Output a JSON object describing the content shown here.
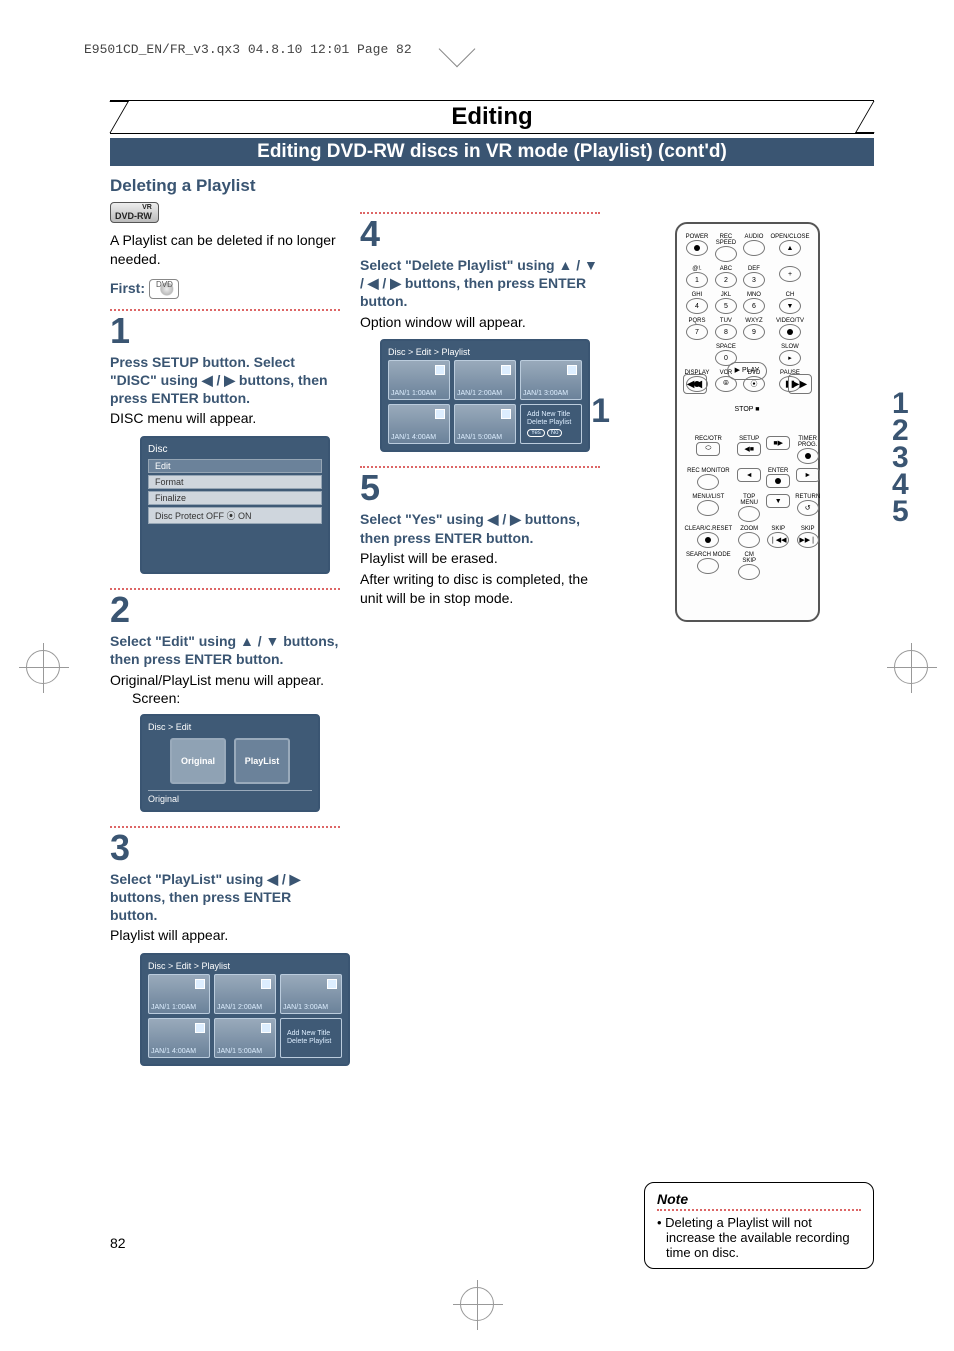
{
  "print_header": "E9501CD_EN/FR_v3.qx3  04.8.10  12:01  Page 82",
  "page_title": "Editing",
  "subtitle": "Editing DVD-RW discs in VR mode (Playlist) (cont'd)",
  "section_heading": "Deleting a Playlist",
  "dvd_badge": {
    "line1": "VR",
    "line2": "DVD-RW"
  },
  "intro": "A Playlist can be deleted if no longer needed.",
  "first_label": "First:",
  "disc_icon_text": "DVD",
  "steps": {
    "s1": {
      "num": "1",
      "instr": "Press SETUP button. Select \"DISC\" using ◀ / ▶ buttons, then press ENTER button.",
      "result": "DISC menu will appear."
    },
    "s2": {
      "num": "2",
      "instr": "Select \"Edit\" using ▲ / ▼ buttons, then press ENTER button.",
      "result": "Original/PlayList menu will appear.",
      "screen_label": "Screen:"
    },
    "s3": {
      "num": "3",
      "instr": "Select \"PlayList\" using ◀ / ▶ buttons, then press ENTER button.",
      "result": "Playlist will appear."
    },
    "s4": {
      "num": "4",
      "instr": "Select \"Delete Playlist\" using ▲ / ▼ / ◀ / ▶ buttons, then press ENTER button.",
      "result": "Option window will appear."
    },
    "s5": {
      "num": "5",
      "instr": "Select \"Yes\" using ◀ / ▶ buttons, then press ENTER button.",
      "result1": "Playlist will be erased.",
      "result2": "After writing to disc is completed, the unit will be in stop mode."
    }
  },
  "disc_menu": {
    "title": "Disc",
    "rows": [
      "Edit",
      "Format",
      "Finalize",
      "Disc Protect OFF ⦿ ON"
    ]
  },
  "edit_menu": {
    "crumb": "Disc > Edit",
    "original": "Original",
    "playlist": "PlayList",
    "footer": "Original"
  },
  "playlist_menu": {
    "crumb": "Disc > Edit > Playlist",
    "items": [
      "JAN/1  1:00AM",
      "JAN/1  2:00AM",
      "JAN/1  3:00AM",
      "JAN/1  4:00AM",
      "JAN/1  5:00AM"
    ],
    "side_menu": [
      "Add New Title",
      "Delete Playlist"
    ]
  },
  "playlist_menu2": {
    "crumb": "Disc > Edit > Playlist",
    "items": [
      "JAN/1  1:00AM",
      "JAN/1  2:00AM",
      "JAN/1  3:00AM",
      "JAN/1  4:00AM",
      "JAN/1  5:00AM"
    ],
    "side_menu": [
      "Add New Title",
      "Delete Playlist"
    ],
    "confirm": {
      "yes": "Yes",
      "no": "No"
    }
  },
  "remote": {
    "row1": [
      "POWER",
      "REC SPEED",
      "AUDIO",
      "OPEN/CLOSE"
    ],
    "row1_face": [
      "●",
      "",
      "",
      "▲"
    ],
    "row2_top": [
      "@!.",
      "ABC",
      "DEF",
      ""
    ],
    "row2": [
      "1",
      "2",
      "3",
      "+"
    ],
    "row3_top": [
      "GHI",
      "JKL",
      "MNO",
      "CH"
    ],
    "row3": [
      "4",
      "5",
      "6",
      "▼"
    ],
    "row4_top": [
      "PQRS",
      "TUV",
      "WXYZ",
      "VIDEO/TV"
    ],
    "row4": [
      "7",
      "8",
      "9",
      "●"
    ],
    "row5_top": [
      "",
      "SPACE",
      "",
      "SLOW"
    ],
    "row5": [
      "",
      "0",
      "",
      "▸"
    ],
    "row6_top": [
      "DISPLAY",
      "VCR",
      "DVD",
      "PAUSE"
    ],
    "row6": [
      "●",
      "⦾",
      "⦿",
      "❚❚"
    ],
    "play": "▶ PLAY",
    "stop": "STOP ■",
    "rew": "◀◀",
    "ff": "▶▶",
    "row7_top": [
      "REC/OTR",
      "SETUP",
      "",
      "TIMER PROG."
    ],
    "row7": [
      "⬭",
      "◀■",
      "■▶",
      "●"
    ],
    "row8_top": [
      "REC MONITOR",
      "",
      "ENTER",
      ""
    ],
    "row8": [
      "○",
      "◄",
      "●",
      "►"
    ],
    "row9_top": [
      "MENU/LIST",
      "TOP MENU",
      "▼",
      "RETURN"
    ],
    "row9": [
      "○",
      "○",
      "▼",
      "↺"
    ],
    "row10_top": [
      "CLEAR/C.RESET",
      "ZOOM",
      "SKIP",
      "SKIP"
    ],
    "row10": [
      "◉",
      "○",
      "❘◀◀",
      "▶▶❘"
    ],
    "row11_top": [
      "SEARCH MODE",
      "CM SKIP",
      "",
      ""
    ],
    "row11": [
      "○",
      "○",
      "",
      ""
    ]
  },
  "remote_left_callout": "1",
  "remote_right_callouts": [
    "1",
    "2",
    "3",
    "4",
    "5"
  ],
  "note": {
    "title": "Note",
    "text": "Deleting a Playlist will not increase the available recording time on disc."
  },
  "page_number": "82"
}
